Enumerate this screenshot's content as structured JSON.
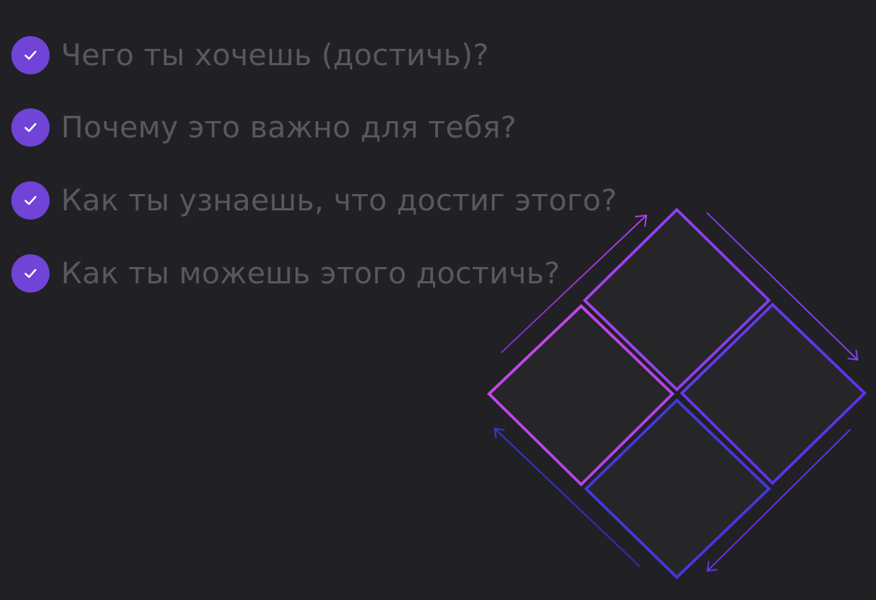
{
  "checklist": {
    "items": [
      {
        "label": "Чего ты хочешь (достичь)?"
      },
      {
        "label": "Почему это важно для тебя?"
      },
      {
        "label": "Как ты узнаешь, что достиг этого?"
      },
      {
        "label": "Как ты можешь этого достичь?"
      }
    ]
  },
  "diagram": {
    "icon": "four-diamond-cycle",
    "colors": {
      "background": "#212024",
      "tile_fill": "#262528",
      "magenta": "#c040e8",
      "purple": "#9040f0",
      "violet": "#6434e8",
      "blue": "#3434d0"
    }
  }
}
